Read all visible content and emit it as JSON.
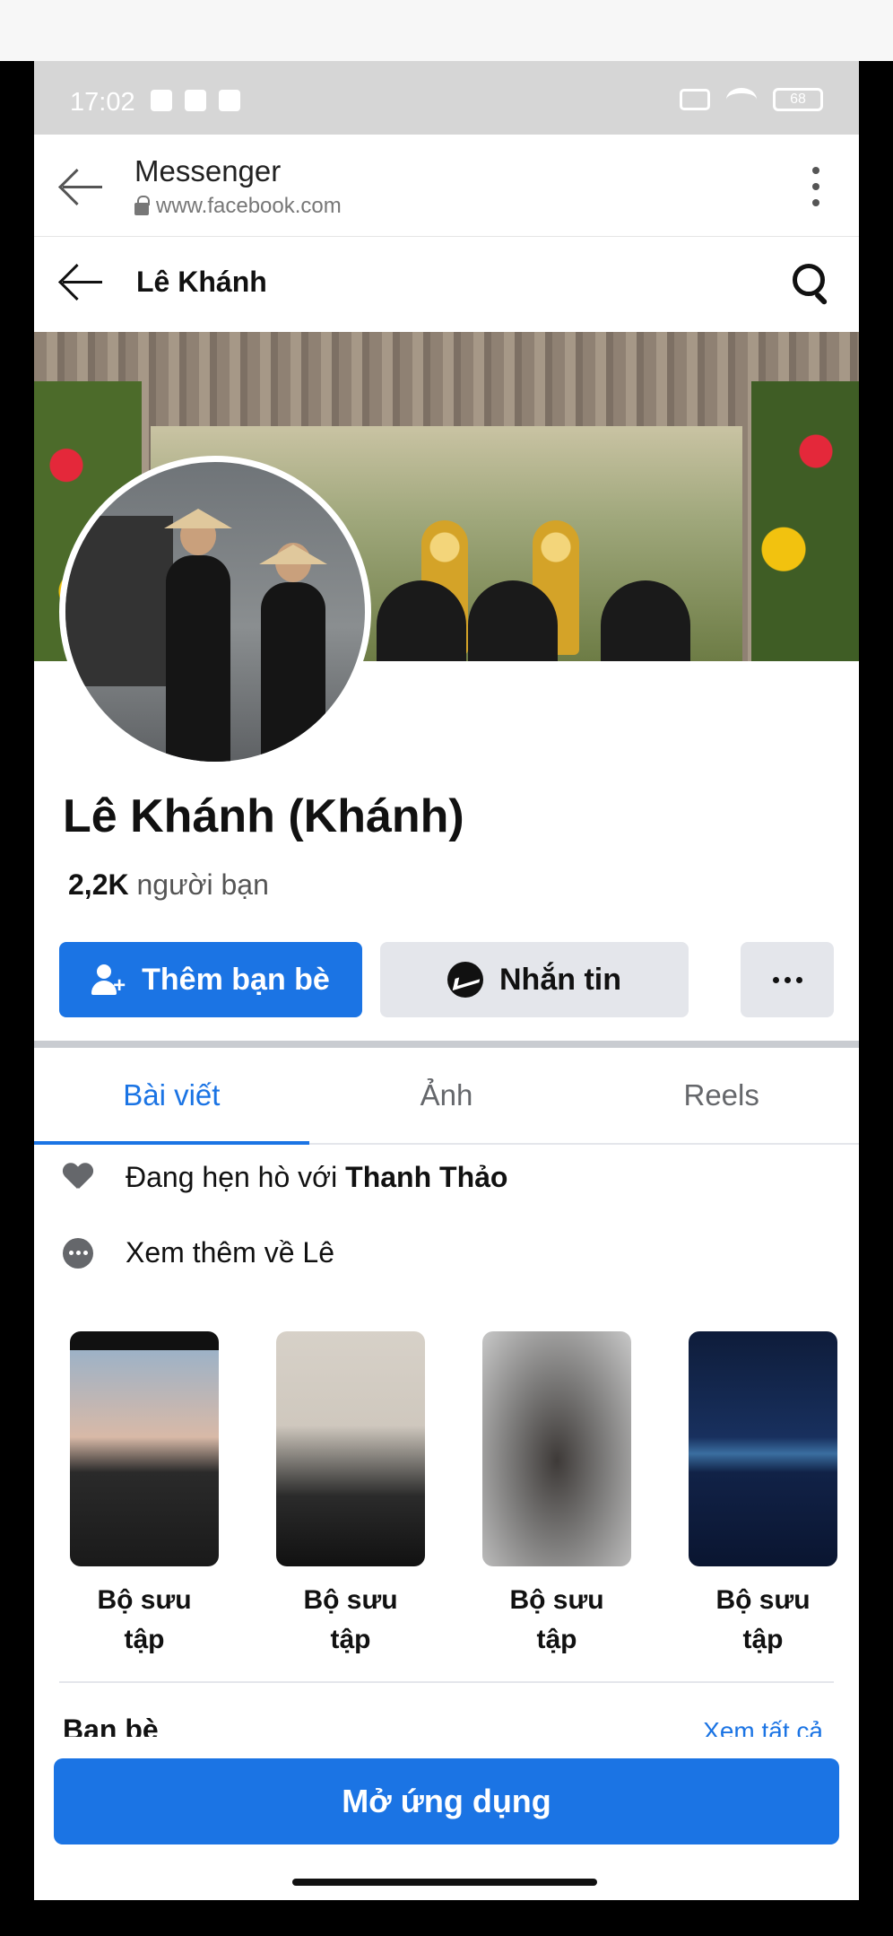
{
  "status_bar": {
    "time": "17:02",
    "battery": "68"
  },
  "browser": {
    "title": "Messenger",
    "url": "www.facebook.com"
  },
  "header": {
    "name": "Lê Khánh"
  },
  "profile": {
    "name": "Lê Khánh (Khánh)",
    "friends_count": "2,2K",
    "friends_suffix": " người bạn"
  },
  "actions": {
    "add_friend": "Thêm bạn bè",
    "message": "Nhắn tin"
  },
  "tabs": [
    {
      "label": "Bài viết",
      "active": true
    },
    {
      "label": "Ảnh",
      "active": false
    },
    {
      "label": "Reels",
      "active": false
    }
  ],
  "info": {
    "relationship_prefix": "Đang hẹn hò với ",
    "relationship_name": "Thanh Thảo",
    "see_more": "Xem thêm về Lê"
  },
  "collections": [
    {
      "label_line1": "Bộ sưu",
      "label_line2": "tập"
    },
    {
      "label_line1": "Bộ sưu",
      "label_line2": "tập"
    },
    {
      "label_line1": "Bộ sưu",
      "label_line2": "tập"
    },
    {
      "label_line1": "Bộ sưu",
      "label_line2": "tập"
    }
  ],
  "friends_section": {
    "title": "Bạn bè",
    "see_all": "Xem tất cả"
  },
  "open_app": "Mở ứng dụng",
  "colors": {
    "accent": "#1b74e4",
    "secondary_button": "#e4e6eb",
    "text_muted": "#65676b"
  }
}
